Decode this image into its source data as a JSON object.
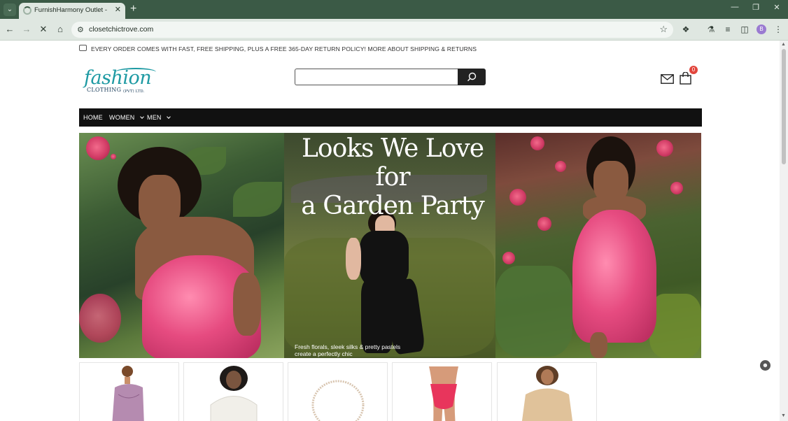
{
  "browser": {
    "tab_title": "FurnishHarmony Outlet - Home",
    "url": "closetchictrove.com",
    "profile_initial": "B"
  },
  "announcement": {
    "text": "EVERY ORDER COMES WITH FAST, FREE SHIPPING, PLUS A FREE 365-DAY RETURN POLICY! MORE ABOUT SHIPPING & RETURNS"
  },
  "logo": {
    "word": "fashion",
    "line1": "CLOTHING",
    "line2": "(PVT) LTD."
  },
  "search": {
    "placeholder": "",
    "value": ""
  },
  "cart": {
    "count": "0"
  },
  "nav": {
    "items": [
      {
        "label": "HOME"
      },
      {
        "label": "WOMEN"
      },
      {
        "label": "MEN"
      }
    ]
  },
  "hero": {
    "title_line1": "Looks We Love for",
    "title_line2": "a Garden Party",
    "caption": "Fresh florals, sleek silks & pretty pastels create a perfectly chic"
  },
  "colors": {
    "navbar": "#111111",
    "logo_teal": "#1e9aa3",
    "badge": "#e2453c",
    "chrome": "#3b5a46"
  }
}
